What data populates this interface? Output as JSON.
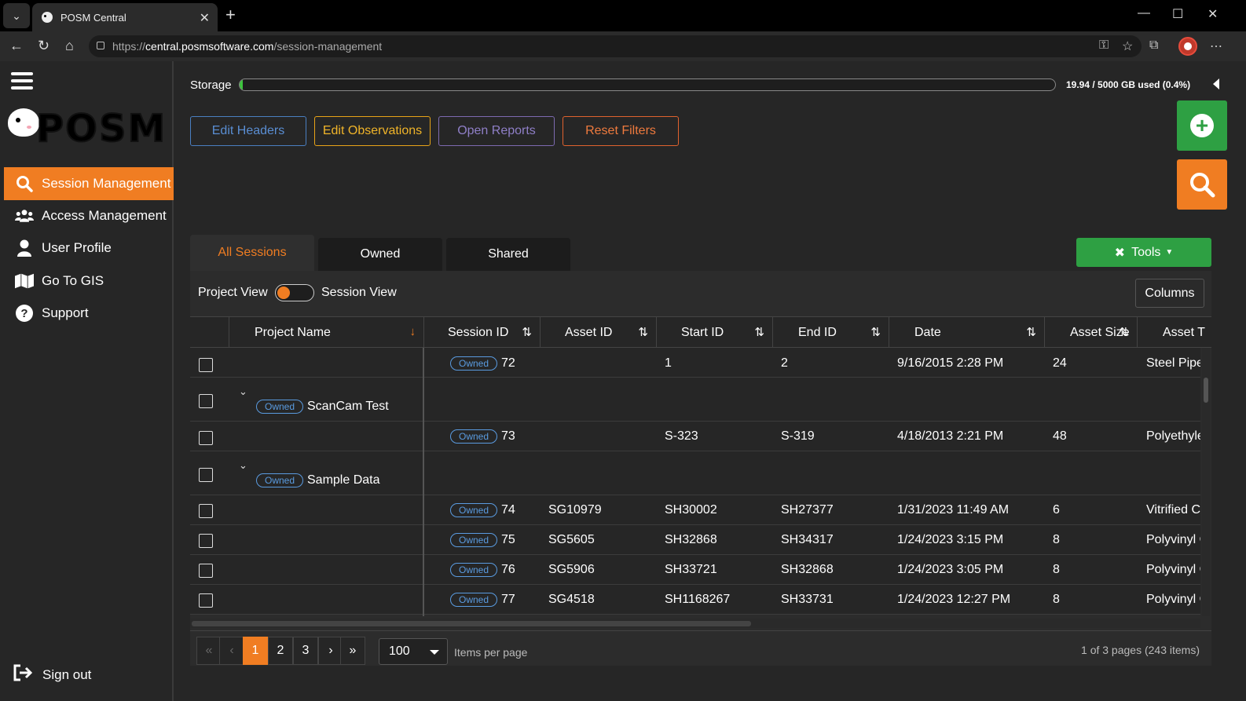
{
  "browser": {
    "tab_title": "POSM Central",
    "url_scheme": "https://",
    "url_host": "central.posmsoftware.com",
    "url_path": "/session-management"
  },
  "sidebar": {
    "logo_text": "POSM",
    "items": [
      {
        "label": "Session Management",
        "icon": "search-icon",
        "active": true
      },
      {
        "label": "Access Management",
        "icon": "users-icon",
        "active": false
      },
      {
        "label": "User Profile",
        "icon": "user-icon",
        "active": false
      },
      {
        "label": "Go To GIS",
        "icon": "map-icon",
        "active": false
      },
      {
        "label": "Support",
        "icon": "question-icon",
        "active": false
      }
    ],
    "signout_label": "Sign out"
  },
  "storage": {
    "label": "Storage",
    "used_fraction": 0.004,
    "text": "19.94 / 5000 GB used (0.4%)"
  },
  "actions": {
    "edit_headers": "Edit Headers",
    "edit_observations": "Edit Observations",
    "open_reports": "Open Reports",
    "reset_filters": "Reset Filters"
  },
  "tabs": [
    "All Sessions",
    "Owned",
    "Shared"
  ],
  "tools_label": "Tools",
  "view_toggle": {
    "left": "Project View",
    "right": "Session View"
  },
  "columns_label": "Columns",
  "table": {
    "headers": [
      "Project Name",
      "Session ID",
      "Asset ID",
      "Start ID",
      "End ID",
      "Date",
      "Asset Size",
      "Asset T"
    ],
    "owned_label": "Owned",
    "rows": [
      {
        "type": "session",
        "session_id": "72",
        "asset_id": "",
        "start_id": "1",
        "end_id": "2",
        "date": "9/16/2015 2:28 PM",
        "asset_size": "24",
        "asset_type": "Steel Pipe"
      },
      {
        "type": "project",
        "name": "ScanCam Test"
      },
      {
        "type": "session",
        "session_id": "73",
        "asset_id": "",
        "start_id": "S-323",
        "end_id": "S-319",
        "date": "4/18/2013 2:21 PM",
        "asset_size": "48",
        "asset_type": "Polyethyle"
      },
      {
        "type": "project",
        "name": "Sample Data"
      },
      {
        "type": "session",
        "session_id": "74",
        "asset_id": "SG10979",
        "start_id": "SH30002",
        "end_id": "SH27377",
        "date": "1/31/2023 11:49 AM",
        "asset_size": "6",
        "asset_type": "Vitrified C"
      },
      {
        "type": "session",
        "session_id": "75",
        "asset_id": "SG5605",
        "start_id": "SH32868",
        "end_id": "SH34317",
        "date": "1/24/2023 3:15 PM",
        "asset_size": "8",
        "asset_type": "Polyvinyl C"
      },
      {
        "type": "session",
        "session_id": "76",
        "asset_id": "SG5906",
        "start_id": "SH33721",
        "end_id": "SH32868",
        "date": "1/24/2023 3:05 PM",
        "asset_size": "8",
        "asset_type": "Polyvinyl C"
      },
      {
        "type": "session",
        "session_id": "77",
        "asset_id": "SG4518",
        "start_id": "SH1168267",
        "end_id": "SH33731",
        "date": "1/24/2023 12:27 PM",
        "asset_size": "8",
        "asset_type": "Polyvinyl C"
      }
    ]
  },
  "pager": {
    "pages": [
      "1",
      "2",
      "3"
    ],
    "current": "1",
    "page_size": "100",
    "items_per_page": "Items per page",
    "info": "1 of 3 pages (243 items)"
  }
}
